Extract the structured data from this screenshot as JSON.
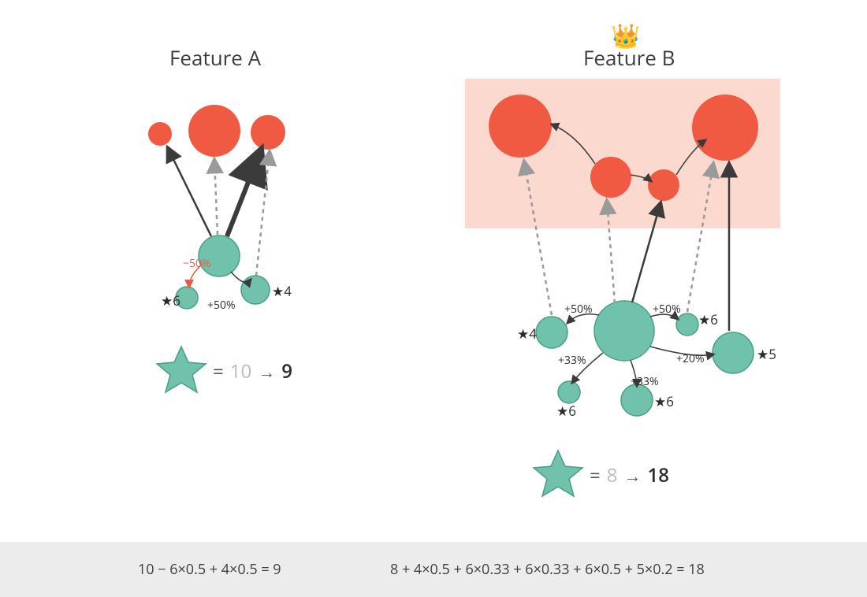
{
  "colors": {
    "orange": "#f15a42",
    "teal": "#71c2ac",
    "tealStroke": "#4a9d88",
    "highlight": "#fcd9ce",
    "arrow": "#3b3b3b",
    "dashed": "#9a9a9a",
    "text": "#3d3d3d",
    "muted": "#bcbcbc"
  },
  "crown_glyph": "👑",
  "panelA": {
    "title": "Feature A",
    "nodes": {
      "star_left": "★6",
      "star_right": "★4",
      "pct_neg": "−50%",
      "pct_pos": "+50%"
    },
    "score": {
      "old": "10",
      "new": "9"
    },
    "calc": "10 − 6×0.5 + 4×0.5 = 9"
  },
  "panelB": {
    "title": "Feature B",
    "nodes": {
      "star_tl": "★4",
      "star_tr": "★6",
      "star_r": "★5",
      "star_bl": "★6",
      "star_br": "★6",
      "pct_tl": "+50%",
      "pct_tr": "+50%",
      "pct_bl": "+33%",
      "pct_br": "+33%",
      "pct_r": "+20%"
    },
    "score": {
      "old": "8",
      "new": "18"
    },
    "calc": "8 + 4×0.5 + 6×0.33 + 6×0.33 + 6×0.5 + 5×0.2 = 18"
  }
}
